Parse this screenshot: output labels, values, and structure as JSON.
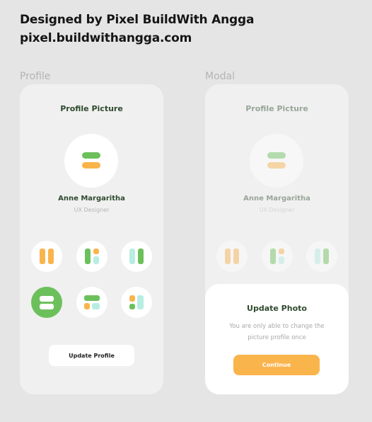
{
  "credit": {
    "line1": "Designed by Pixel BuildWith Angga",
    "line2": "pixel.buildwithangga.com"
  },
  "profile_screen": {
    "section_label": "Profile",
    "title": "Profile Picture",
    "user_name": "Anne Margaritha",
    "user_role": "UX Designer",
    "update_button": "Update Profile"
  },
  "modal_screen": {
    "section_label": "Modal",
    "title": "Profile Picture",
    "user_name": "Anne Margaritha",
    "user_role": "UX Designer",
    "modal": {
      "title": "Update Photo",
      "message": "You are only able to change the picture profile once",
      "continue_button": "Continue"
    }
  },
  "colors": {
    "green": "#6cc05c",
    "orange": "#fab44c",
    "mint": "#b8ede2",
    "phone_bg": "#f0f0f0",
    "page_bg": "#e5e5e5"
  },
  "avatar_options": [
    "avatar-option-orange-pillars",
    "avatar-option-green-orange-mint-tiles",
    "avatar-option-mint-pillars",
    "avatar-option-green-white-bars",
    "avatar-option-green-orange-mint-rows",
    "avatar-option-orange-green-mint-split"
  ],
  "selected_avatar_option": 3
}
